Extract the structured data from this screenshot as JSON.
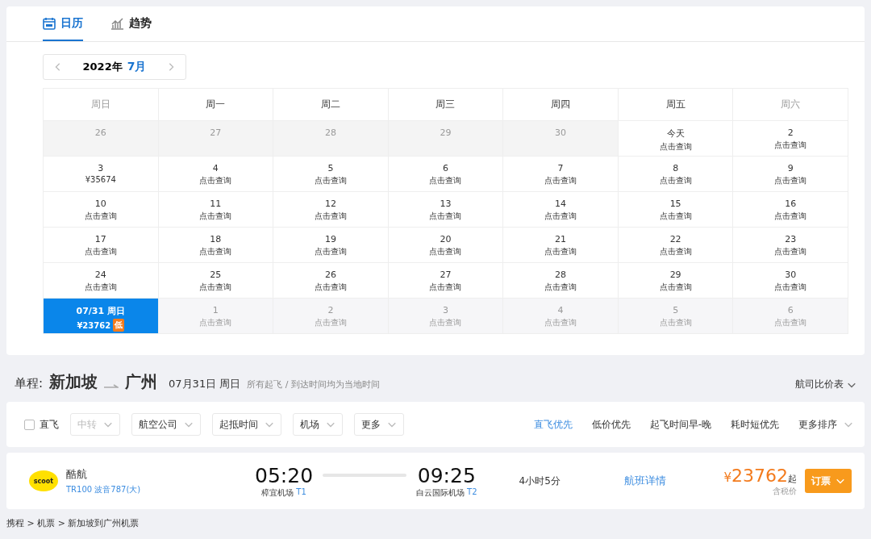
{
  "tabs": [
    {
      "label": "日历",
      "kind": "calendar",
      "selected": true
    },
    {
      "label": "趋势",
      "kind": "chart",
      "selected": false
    }
  ],
  "month_nav": {
    "year": "2022年",
    "month": "7月"
  },
  "weekdays": [
    {
      "label": "周日",
      "weekend": true
    },
    {
      "label": "周一",
      "weekend": false
    },
    {
      "label": "周二",
      "weekend": false
    },
    {
      "label": "周三",
      "weekend": false
    },
    {
      "label": "周四",
      "weekend": false
    },
    {
      "label": "周五",
      "weekend": false
    },
    {
      "label": "周六",
      "weekend": true
    }
  ],
  "weeks": [
    [
      {
        "day": "26",
        "kind": "past",
        "selected": false
      },
      {
        "day": "27",
        "kind": "past",
        "selected": false
      },
      {
        "day": "28",
        "kind": "past",
        "selected": false
      },
      {
        "day": "29",
        "kind": "past",
        "selected": false
      },
      {
        "day": "30",
        "kind": "past",
        "selected": false
      },
      {
        "day": "今天",
        "note": "点击查询",
        "kind": "normal",
        "selected": false
      },
      {
        "day": "2",
        "note": "点击查询",
        "kind": "normal",
        "selected": false
      }
    ],
    [
      {
        "day": "3",
        "note": "¥35674",
        "kind": "normal",
        "selected": false
      },
      {
        "day": "4",
        "note": "点击查询",
        "kind": "normal",
        "selected": false
      },
      {
        "day": "5",
        "note": "点击查询",
        "kind": "normal",
        "selected": false
      },
      {
        "day": "6",
        "note": "点击查询",
        "kind": "normal",
        "selected": false
      },
      {
        "day": "7",
        "note": "点击查询",
        "kind": "normal",
        "selected": false
      },
      {
        "day": "8",
        "note": "点击查询",
        "kind": "normal",
        "selected": false
      },
      {
        "day": "9",
        "note": "点击查询",
        "kind": "normal",
        "selected": false
      }
    ],
    [
      {
        "day": "10",
        "note": "点击查询",
        "kind": "normal",
        "selected": false
      },
      {
        "day": "11",
        "note": "点击查询",
        "kind": "normal",
        "selected": false
      },
      {
        "day": "12",
        "note": "点击查询",
        "kind": "normal",
        "selected": false
      },
      {
        "day": "13",
        "note": "点击查询",
        "kind": "normal",
        "selected": false
      },
      {
        "day": "14",
        "note": "点击查询",
        "kind": "normal",
        "selected": false
      },
      {
        "day": "15",
        "note": "点击查询",
        "kind": "normal",
        "selected": false
      },
      {
        "day": "16",
        "note": "点击查询",
        "kind": "normal",
        "selected": false
      }
    ],
    [
      {
        "day": "17",
        "note": "点击查询",
        "kind": "normal",
        "selected": false
      },
      {
        "day": "18",
        "note": "点击查询",
        "kind": "normal",
        "selected": false
      },
      {
        "day": "19",
        "note": "点击查询",
        "kind": "normal",
        "selected": false
      },
      {
        "day": "20",
        "note": "点击查询",
        "kind": "normal",
        "selected": false
      },
      {
        "day": "21",
        "note": "点击查询",
        "kind": "normal",
        "selected": false
      },
      {
        "day": "22",
        "note": "点击查询",
        "kind": "normal",
        "selected": false
      },
      {
        "day": "23",
        "note": "点击查询",
        "kind": "normal",
        "selected": false
      }
    ],
    [
      {
        "day": "24",
        "note": "点击查询",
        "kind": "normal",
        "selected": false
      },
      {
        "day": "25",
        "note": "点击查询",
        "kind": "normal",
        "selected": false
      },
      {
        "day": "26",
        "note": "点击查询",
        "kind": "normal",
        "selected": false
      },
      {
        "day": "27",
        "note": "点击查询",
        "kind": "normal",
        "selected": false
      },
      {
        "day": "28",
        "note": "点击查询",
        "kind": "normal",
        "selected": false
      },
      {
        "day": "29",
        "note": "点击查询",
        "kind": "normal",
        "selected": false
      },
      {
        "day": "30",
        "note": "点击查询",
        "kind": "normal",
        "selected": false
      }
    ],
    [
      {
        "day": "07/31 周日",
        "note": "¥23762",
        "badge": "低",
        "kind": "normal",
        "selected": true
      },
      {
        "day": "1",
        "note": "点击查询",
        "kind": "next",
        "selected": false
      },
      {
        "day": "2",
        "note": "点击查询",
        "kind": "next",
        "selected": false
      },
      {
        "day": "3",
        "note": "点击查询",
        "kind": "next",
        "selected": false
      },
      {
        "day": "4",
        "note": "点击查询",
        "kind": "next",
        "selected": false
      },
      {
        "day": "5",
        "note": "点击查询",
        "kind": "next",
        "selected": false
      },
      {
        "day": "6",
        "note": "点击查询",
        "kind": "next",
        "selected": false
      }
    ]
  ],
  "route": {
    "prefix": "单程:",
    "from": "新加坡",
    "to": "广州",
    "date": "07月31日 周日",
    "hint": "所有起飞 / 到达时间均为当地时间",
    "compare": "航司比价表"
  },
  "filters": {
    "direct": {
      "label": "直飞",
      "checked": false
    },
    "dropdowns": [
      {
        "label": "中转",
        "disabled": true
      },
      {
        "label": "航空公司",
        "disabled": false
      },
      {
        "label": "起抵时间",
        "disabled": false
      },
      {
        "label": "机场",
        "disabled": false
      },
      {
        "label": "更多",
        "disabled": false
      }
    ],
    "sorts": [
      {
        "label": "直飞优先",
        "selected": true
      },
      {
        "label": "低价优先",
        "selected": false
      },
      {
        "label": "起飞时间早-晚",
        "selected": false
      },
      {
        "label": "耗时短优先",
        "selected": false
      }
    ],
    "more_sort": "更多排序"
  },
  "flight": {
    "logo": "scoot",
    "airline": "酷航",
    "number": "TR100 波音787(大)",
    "depart_time": "05:20",
    "depart_airport": "樟宜机场",
    "depart_terminal": "T1",
    "arrive_time": "09:25",
    "arrive_airport": "白云国际机场",
    "arrive_terminal": "T2",
    "duration": "4小时5分",
    "details": "航班详情",
    "currency": "¥",
    "price": "23762",
    "price_suffix": "起",
    "tax_note": "含税价",
    "book": "订票"
  },
  "breadcrumb": "携程 > 机票 > 新加坡到广州机票"
}
